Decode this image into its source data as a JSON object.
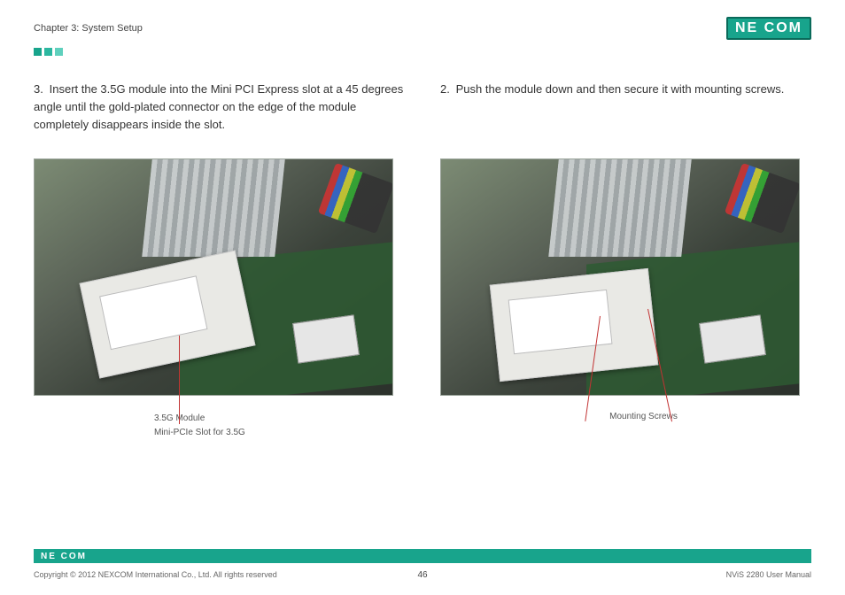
{
  "header": {
    "chapter": "Chapter 3: System Setup",
    "brand": "NE COM"
  },
  "steps": {
    "left": {
      "number": "3.",
      "text": "Insert the 3.5G module into the Mini PCI Express slot at a 45 degrees angle until the gold-plated connector on the edge of the module completely disappears inside the slot."
    },
    "right": {
      "number": "2.",
      "text": "Push the module down and then secure it with mounting screws."
    }
  },
  "captions": {
    "left_line1": "3.5G Module",
    "left_line2": "Mini-PCIe Slot for 3.5G",
    "right_line1": "Mounting Screws"
  },
  "footer": {
    "brand_small": "NE COM",
    "copyright": "Copyright © 2012 NEXCOM International Co., Ltd. All rights reserved",
    "page_number": "46",
    "doc_title": "NViS 2280 User Manual"
  }
}
